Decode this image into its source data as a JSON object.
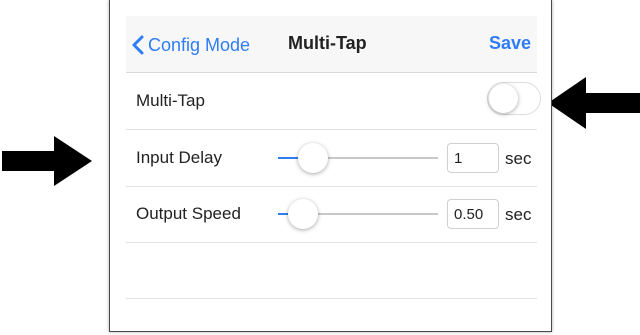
{
  "navbar": {
    "back_label": "Config Mode",
    "title": "Multi-Tap",
    "save_label": "Save"
  },
  "rows": {
    "multitap": {
      "label": "Multi-Tap",
      "enabled": false
    },
    "input_delay": {
      "label": "Input Delay",
      "value": "1",
      "unit": "sec",
      "slider_fraction": 0.15
    },
    "output_speed": {
      "label": "Output Speed",
      "value": "0.50",
      "unit": "sec",
      "slider_fraction": 0.08
    }
  },
  "colors": {
    "accent": "#2f7df6",
    "arrow": "#000000"
  },
  "annotations": {
    "arrows": [
      "arrow-right-icon",
      "arrow-left-icon"
    ]
  }
}
